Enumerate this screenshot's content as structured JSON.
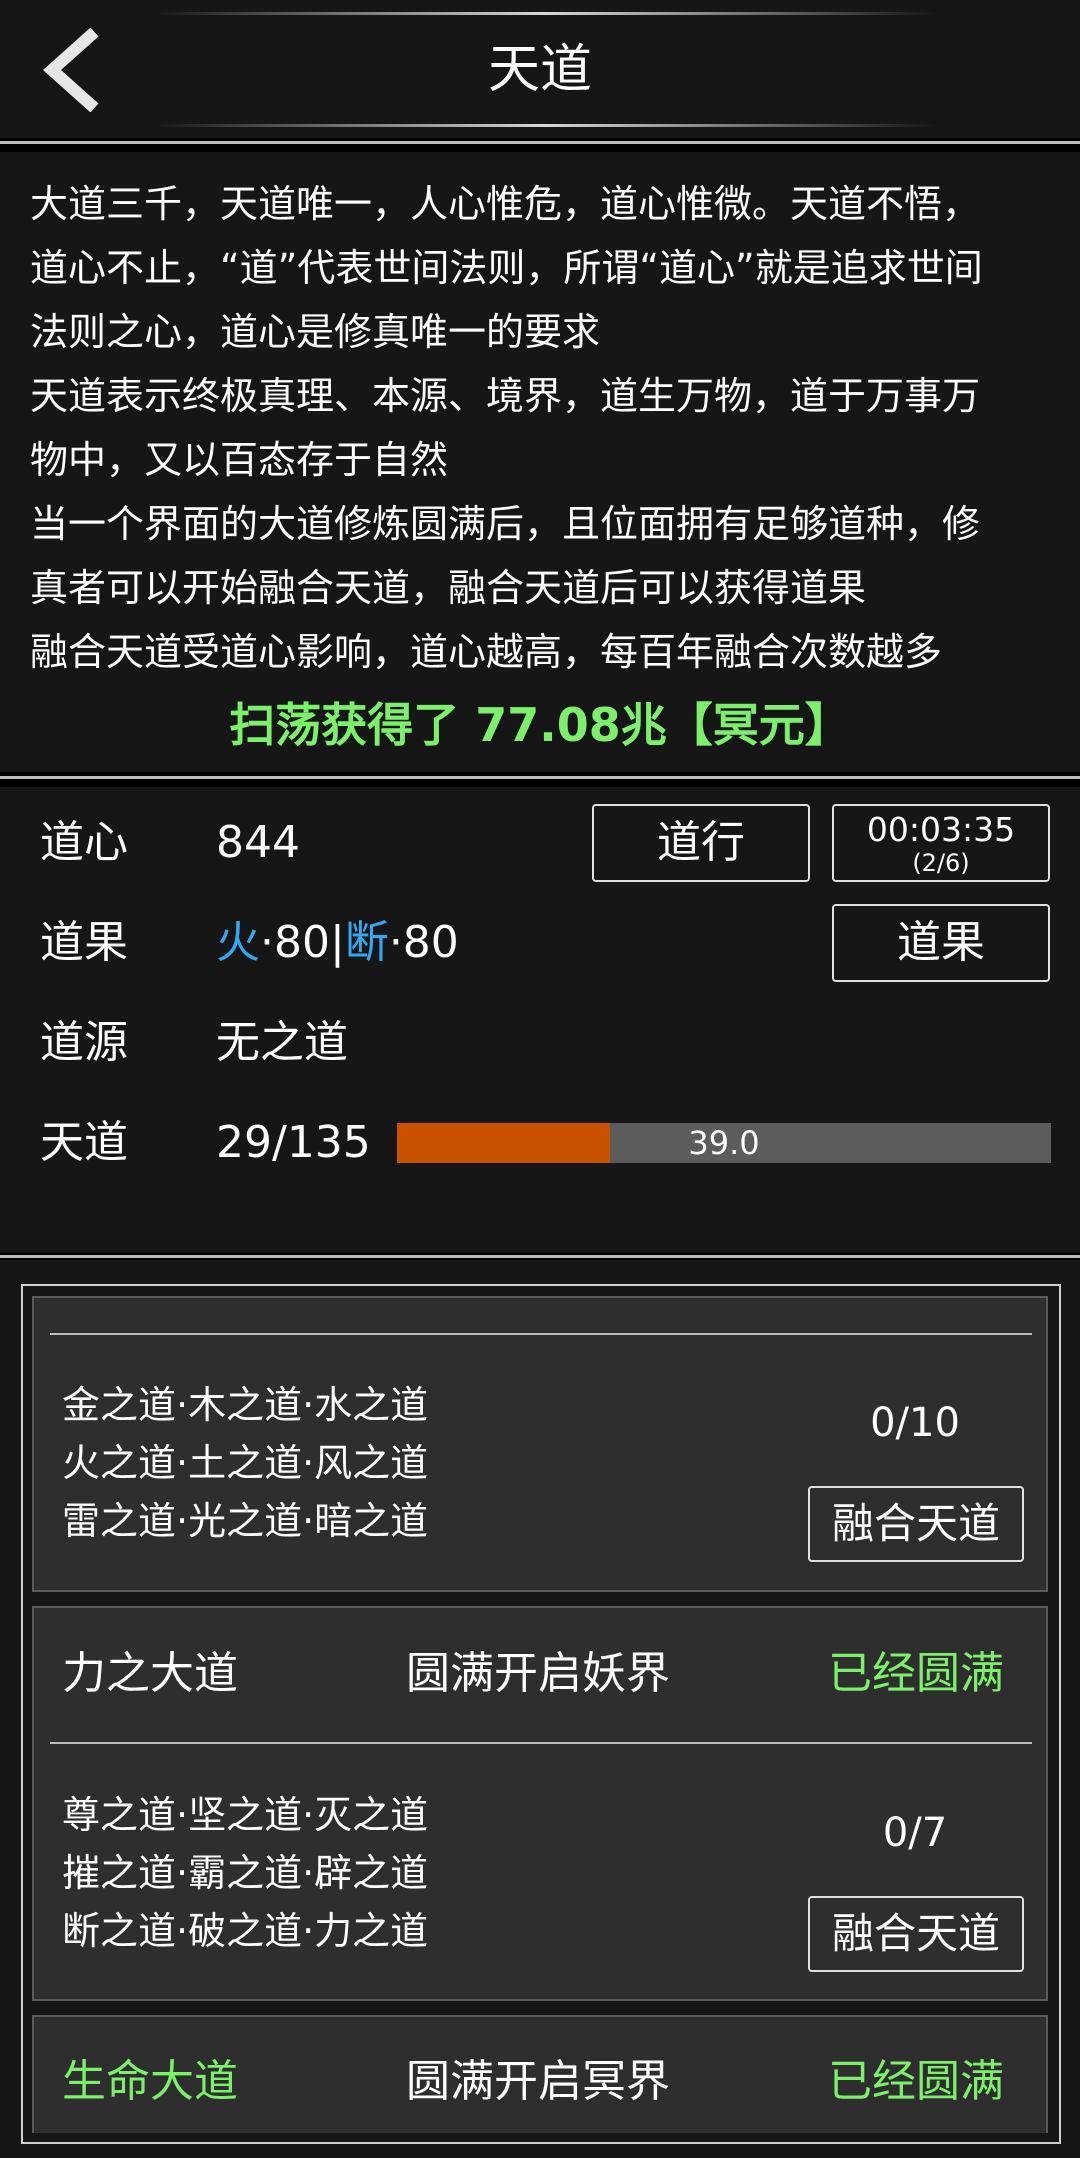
{
  "header": {
    "title": "天道"
  },
  "description": {
    "lines": [
      "大道三千，天道唯一，人心惟危，道心惟微。天道不悟，",
      "道心不止，“道”代表世间法则，所谓“道心”就是追求世间",
      "法则之心，道心是修真唯一的要求",
      "天道表示终极真理、本源、境界，道生万物，道于万事万",
      "物中，又以百态存于自然",
      "当一个界面的大道修炼圆满后，且位面拥有足够道种，修",
      "真者可以开始融合天道，融合天道后可以获得道果",
      "融合天道受道心影响，道心越高，每百年融合次数越多"
    ],
    "loot_message": "扫荡获得了 77.08兆【冥元】"
  },
  "stats": {
    "daoxin_label": "道心",
    "daoxin_value": "844",
    "daoguo_label": "道果",
    "daoguo_parts": {
      "a_name": "火",
      "a_level": "·80",
      "divider": "|",
      "b_name": "断",
      "b_level": "·80"
    },
    "daoyuan_label": "道源",
    "daoyuan_value": "无之道",
    "tiandao_label": "天道",
    "tiandao_value": "29/135",
    "progress_text": "39.0",
    "progress_fraction": 0.326,
    "daoxing_button": "道行",
    "timer": "00:03:35",
    "timer_sub": "(2/6)",
    "daoguo_button": "道果"
  },
  "paths": {
    "group1": {
      "lines": [
        "金之道·木之道·水之道",
        "火之道·土之道·风之道",
        "雷之道·光之道·暗之道"
      ],
      "count": "0/10",
      "fuse_button": "融合天道"
    },
    "row_power": {
      "name": "力之大道",
      "unlock": "圆满开启妖界",
      "status": "已经圆满"
    },
    "group2": {
      "lines": [
        "尊之道·坚之道·灭之道",
        "摧之道·霸之道·辟之道",
        "断之道·破之道·力之道"
      ],
      "count": "0/7",
      "fuse_button": "融合天道"
    },
    "row_life": {
      "name": "生命大道",
      "unlock": "圆满开启冥界",
      "status": "已经圆满"
    }
  },
  "colors": {
    "green": "#7cf06a",
    "blue": "#2ea9f2",
    "progress_fill": "#c95200"
  }
}
